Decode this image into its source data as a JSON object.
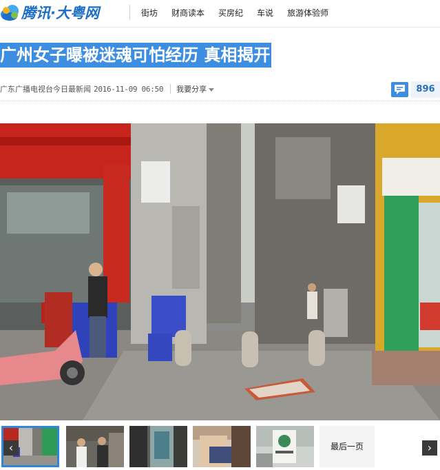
{
  "header": {
    "logo_text": "腾讯·大粤网",
    "nav": [
      "街坊",
      "财商读本",
      "买房纪",
      "车说",
      "旅游体验师"
    ]
  },
  "article": {
    "title": "广州女子曝被迷魂可怕经历 真相揭开",
    "source": "广东广播电视台今日最新闻",
    "date": "2016-11-09 06:50",
    "share_label": "我要分享",
    "comment_count": "896"
  },
  "gallery": {
    "prev_label": "‹",
    "next_label": "›",
    "last_page_label": "最后一页",
    "thumbnails": 5
  },
  "colors": {
    "brand_blue": "#3d8ee0",
    "logo_blue": "#1d6fc7",
    "active_thumb_border": "#2f86d8"
  },
  "icons": {
    "comment": "comment-bubble-icon",
    "share_caret": "chevron-down-icon",
    "prev": "chevron-left-icon",
    "next": "chevron-right-icon"
  }
}
